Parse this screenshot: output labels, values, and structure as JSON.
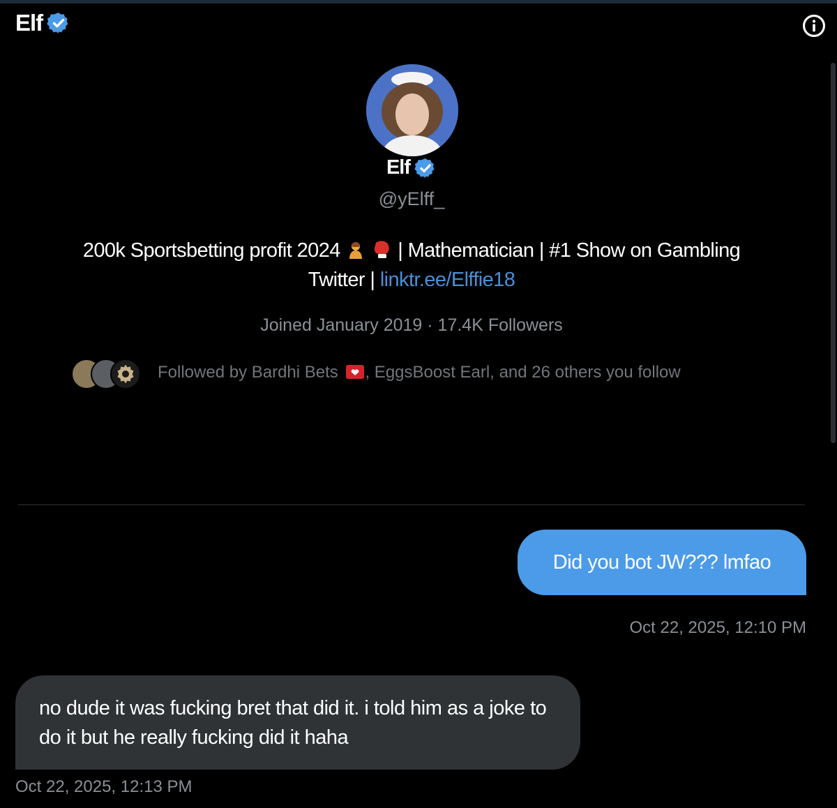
{
  "header": {
    "title": "Elf",
    "verified_icon": "verified-badge-icon",
    "info_icon": "info-icon"
  },
  "profile": {
    "name": "Elf",
    "handle": "@yElff_",
    "bio_text": "200k Sportsbetting profit 2024",
    "bio_emoji_1": "woman-gesturing-emoji",
    "bio_emoji_2": "boxing-glove-emoji",
    "bio_text_2": "| Mathematician | #1 Show on Gambling Twitter |",
    "bio_link": "linktr.ee/Elffie18",
    "meta": "Joined January 2019 · 17.4K Followers",
    "followed_prefix": "Followed by Bardhi Bets",
    "followed_suffix": ", EggsBoost Earl, and 26 others you follow"
  },
  "messages": [
    {
      "direction": "outgoing",
      "text": "Did you bot JW??? lmfao",
      "timestamp": "Oct 22, 2025, 12:10 PM"
    },
    {
      "direction": "incoming",
      "text": "no dude it was fucking bret that did it. i told him as a joke to do it but he really fucking did it haha",
      "timestamp": "Oct 22, 2025, 12:13 PM"
    }
  ],
  "colors": {
    "accent": "#4c9be8",
    "link": "#4a8fd6",
    "incoming_bubble": "#2f3336",
    "background": "#000000",
    "muted_text": "#8b9096"
  }
}
